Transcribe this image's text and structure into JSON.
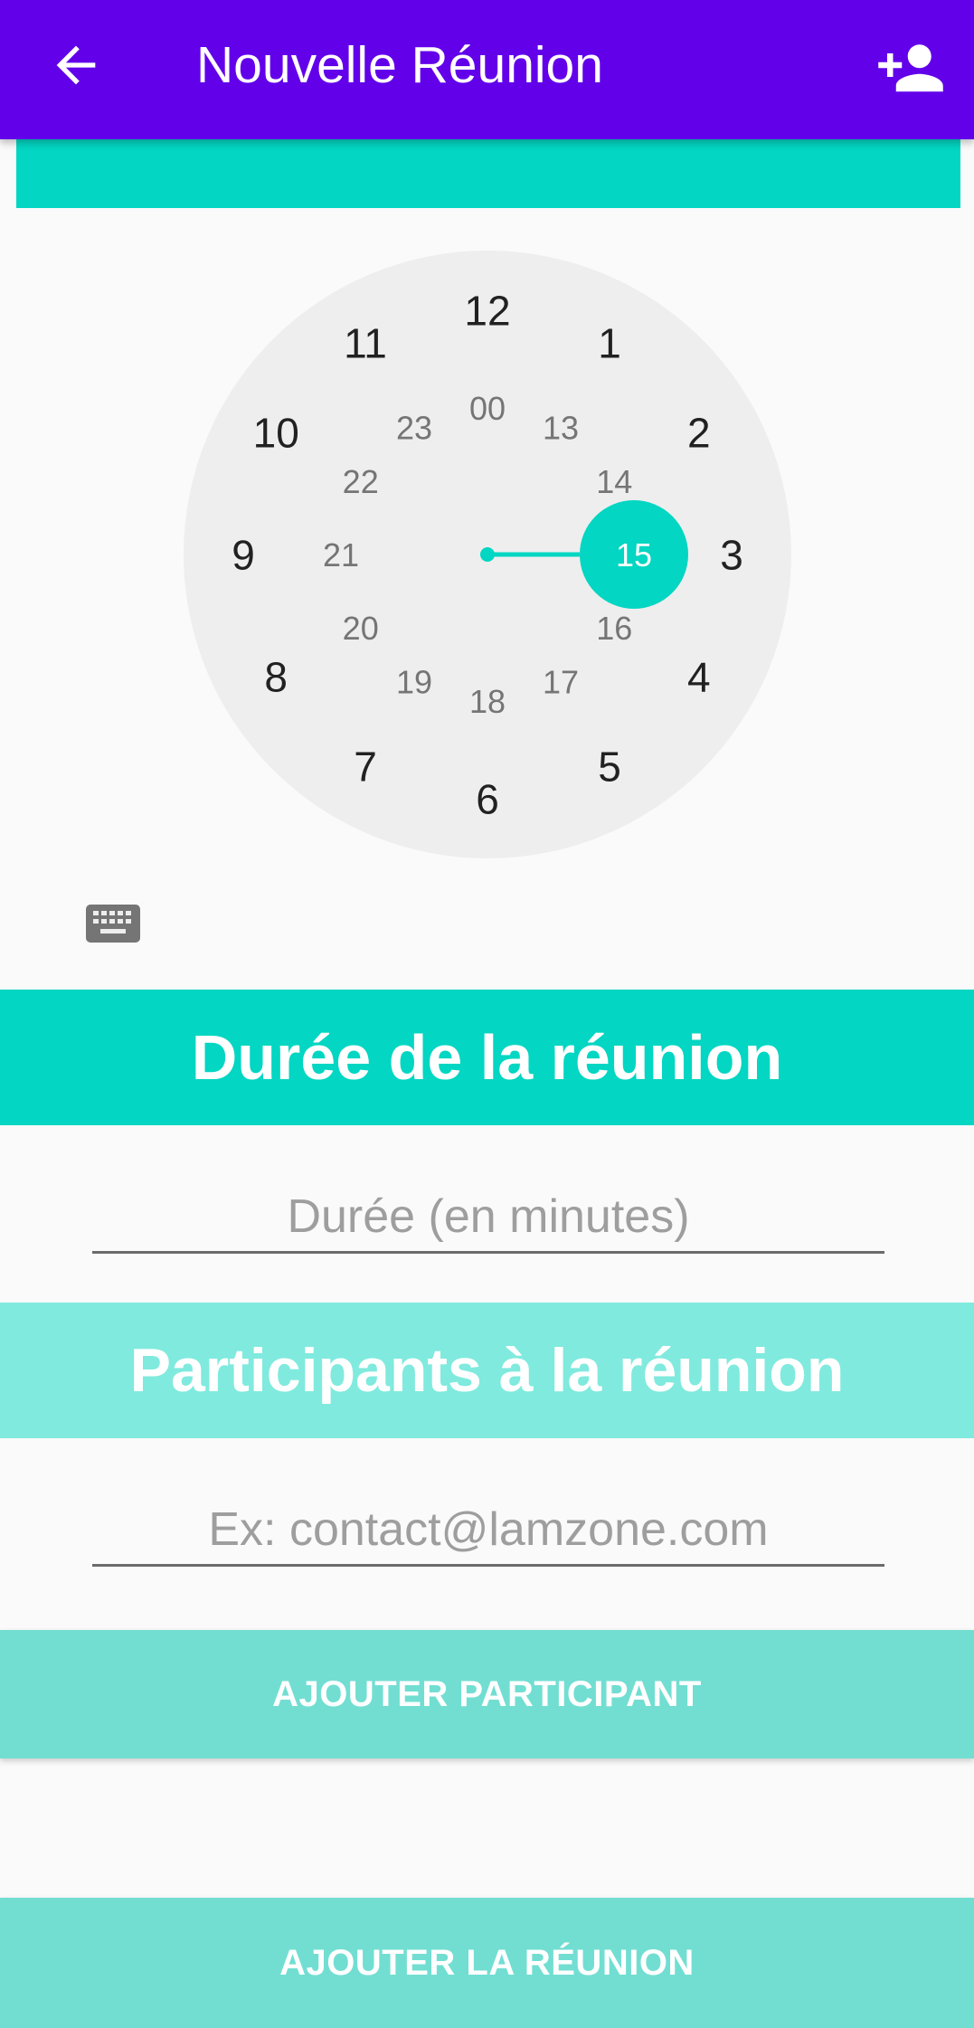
{
  "appbar": {
    "title": "Nouvelle Réunion",
    "back_icon": "arrow-back-icon",
    "add_person_icon": "person-add-icon",
    "color": "#6200ea"
  },
  "time_picker": {
    "header_color": "#03d6c2",
    "accent_color": "#03d6c2",
    "selected_hour": "15",
    "outer_hours": [
      "12",
      "1",
      "2",
      "3",
      "4",
      "5",
      "6",
      "7",
      "8",
      "9",
      "10",
      "11"
    ],
    "inner_hours": [
      "00",
      "13",
      "14",
      "15",
      "16",
      "17",
      "18",
      "19",
      "20",
      "21",
      "22",
      "23"
    ],
    "keyboard_icon": "keyboard-icon"
  },
  "duration": {
    "heading": "Durée de la réunion",
    "placeholder": "Durée (en minutes)",
    "value": ""
  },
  "participants": {
    "heading": "Participants à la réunion",
    "placeholder": "Ex: contact@lamzone.com",
    "value": "",
    "add_button": "AJOUTER PARTICIPANT"
  },
  "footer": {
    "add_meeting_button": "AJOUTER LA RÉUNION"
  }
}
